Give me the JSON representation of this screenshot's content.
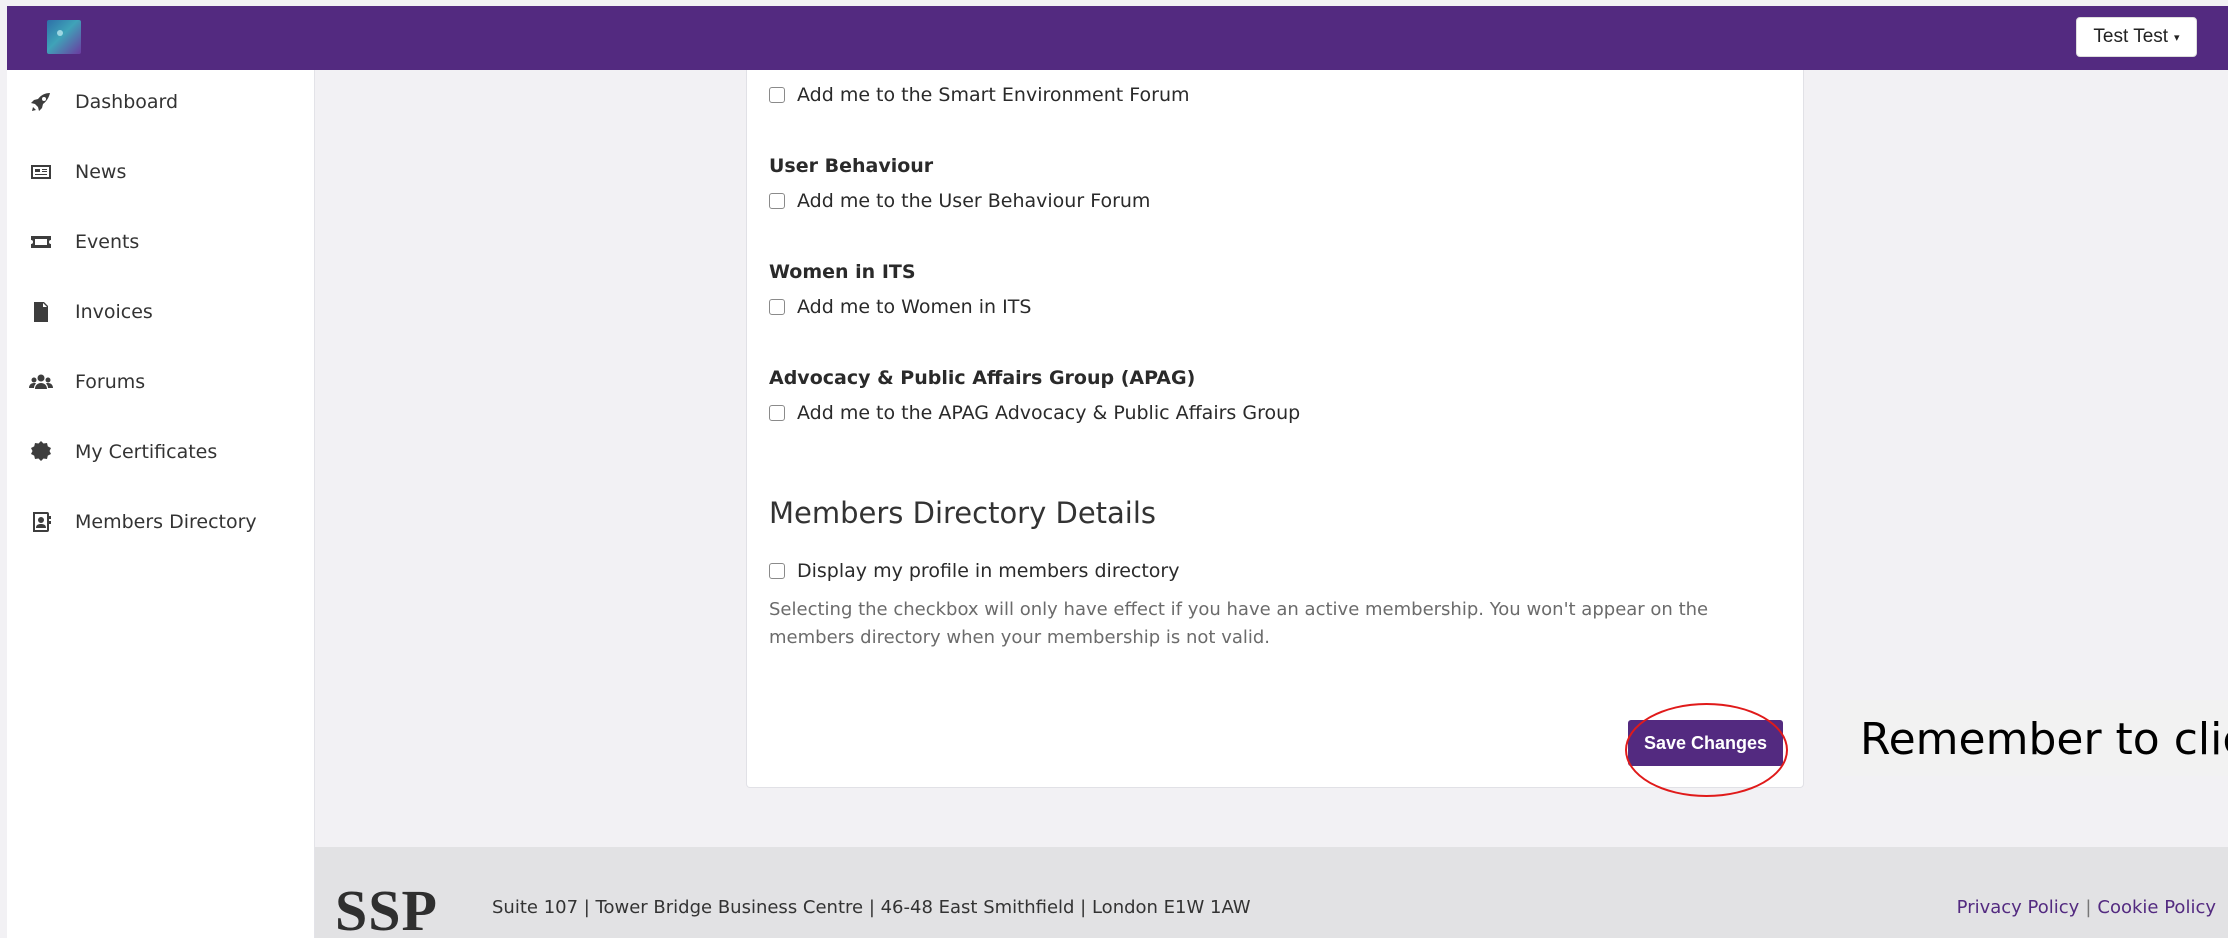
{
  "header": {
    "user_menu_label": "Test Test"
  },
  "sidebar": {
    "items": [
      {
        "label": "Dashboard",
        "icon": "rocket-icon"
      },
      {
        "label": "News",
        "icon": "newspaper-icon"
      },
      {
        "label": "Events",
        "icon": "ticket-icon"
      },
      {
        "label": "Invoices",
        "icon": "invoice-icon"
      },
      {
        "label": "Forums",
        "icon": "users-icon"
      },
      {
        "label": "My Certificates",
        "icon": "certificate-icon"
      },
      {
        "label": "Members Directory",
        "icon": "address-book-icon"
      }
    ]
  },
  "main": {
    "groups": [
      {
        "title": "",
        "checkbox_label": "Add me to the Smart Environment Forum",
        "checked": false
      },
      {
        "title": "User Behaviour",
        "checkbox_label": "Add me to the User Behaviour Forum",
        "checked": false
      },
      {
        "title": "Women in ITS",
        "checkbox_label": "Add me to Women in ITS",
        "checked": false
      },
      {
        "title": "Advocacy & Public Affairs Group (APAG)",
        "checkbox_label": "Add me to the APAG Advocacy & Public Affairs Group",
        "checked": false
      }
    ],
    "directory": {
      "section_title": "Members Directory Details",
      "checkbox_label": "Display my profile in members directory",
      "checked": false,
      "help_text": "Selecting the checkbox will only have effect if you have an active membership. You won't appear on the members directory when your membership is not valid."
    },
    "save_label": "Save Changes"
  },
  "callout": {
    "text": "Remember to click Save Changes"
  },
  "footer": {
    "logo_text": "SSP",
    "address": "Suite 107 | Tower Bridge Business Centre | 46-48 East Smithfield | London E1W 1AW",
    "privacy_label": "Privacy Policy",
    "cookie_label": "Cookie Policy",
    "separator": "|"
  },
  "colors": {
    "brand_purple": "#532a80",
    "highlight_red": "#e01a1a"
  }
}
